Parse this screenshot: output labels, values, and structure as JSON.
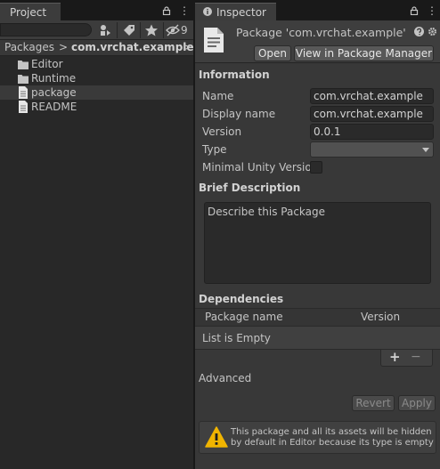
{
  "project": {
    "tab_label": "Project",
    "hidden_count": "9",
    "breadcrumb": {
      "root": "Packages",
      "separator": ">",
      "current": "com.vrchat.example",
      "more": ">"
    },
    "items": [
      {
        "label": "Editor",
        "icon": "folder-icon"
      },
      {
        "label": "Runtime",
        "icon": "folder-icon"
      },
      {
        "label": "package",
        "icon": "document-icon"
      },
      {
        "label": "README",
        "icon": "document-icon"
      }
    ]
  },
  "inspector": {
    "tab_label": "Inspector",
    "title": "Package 'com.vrchat.example'",
    "open_label": "Open",
    "view_label": "View in Package Manager",
    "information": {
      "heading": "Information",
      "name_label": "Name",
      "name_value": "com.vrchat.example",
      "display_name_label": "Display name",
      "display_name_value": "com.vrchat.example",
      "version_label": "Version",
      "version_value": "0.0.1",
      "type_label": "Type",
      "type_value": "",
      "min_unity_label": "Minimal Unity Version"
    },
    "brief": {
      "heading": "Brief Description",
      "text": "Describe this Package"
    },
    "dependencies": {
      "heading": "Dependencies",
      "col_name": "Package name",
      "col_version": "Version",
      "empty_text": "List is Empty",
      "add": "+",
      "remove": "−"
    },
    "advanced_label": "Advanced",
    "revert_label": "Revert",
    "apply_label": "Apply",
    "warning_text": "This package and all its assets will be hidden by default in Editor because its type is empty"
  },
  "colors": {
    "background": "#383838",
    "panel_dark": "#282828",
    "warning_yellow": "#f0b400"
  }
}
